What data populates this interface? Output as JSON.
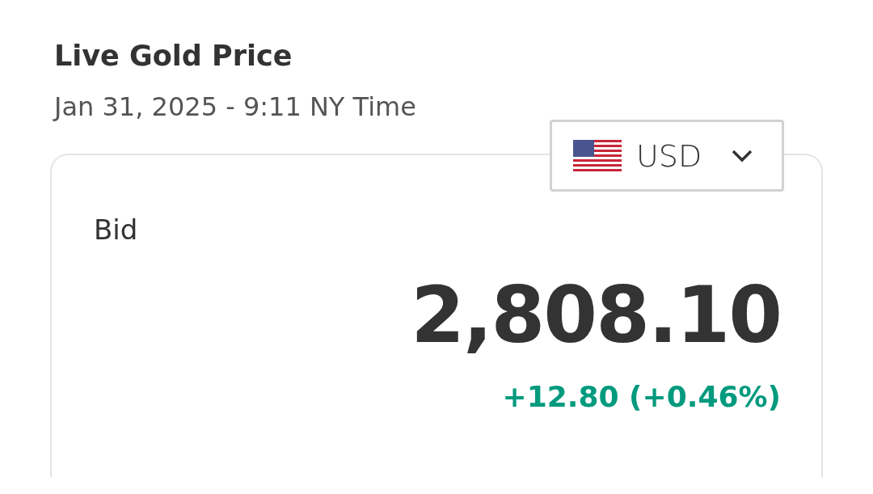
{
  "title": "Live Gold Price",
  "timestamp": "Jan 31, 2025 - 9:11 NY Time",
  "currency_select": {
    "value": "USD"
  },
  "quote": {
    "label": "Bid",
    "price": "2,808.10",
    "change": "+12.80 (+0.46%)",
    "rising": true
  }
}
